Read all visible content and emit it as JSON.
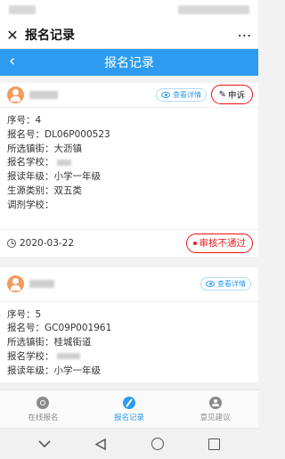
{
  "window": {
    "title": "报名记录",
    "close_icon": "✕",
    "more_icon": "⋯"
  },
  "header": {
    "title": "报名记录",
    "back_icon": "‹"
  },
  "records": [
    {
      "detail_label": "查看详情",
      "appeal_label": "申诉",
      "fields": [
        {
          "label": "序号：",
          "value": "4"
        },
        {
          "label": "报名号：",
          "value": "DL06P000523"
        },
        {
          "label": "所选镇街：",
          "value": "大沥镇"
        },
        {
          "label": "报名学校：",
          "value": ""
        },
        {
          "label": "报读年级：",
          "value": "小学一年级"
        },
        {
          "label": "生源类别：",
          "value": "双五类"
        },
        {
          "label": "调剂学校：",
          "value": ""
        }
      ],
      "date": "2020-03-22",
      "status": "审核不通过"
    },
    {
      "detail_label": "查看详情",
      "fields": [
        {
          "label": "序号：",
          "value": "5"
        },
        {
          "label": "报名号：",
          "value": "GC09P001961"
        },
        {
          "label": "所选镇街：",
          "value": "桂城街道"
        },
        {
          "label": "报名学校：",
          "value": ""
        },
        {
          "label": "报读年级：",
          "value": "小学一年级"
        }
      ]
    }
  ],
  "tabbar": {
    "items": [
      {
        "label": "在线报名",
        "icon": "register-icon",
        "active": false
      },
      {
        "label": "报名记录",
        "icon": "record-icon",
        "active": true
      },
      {
        "label": "意见建议",
        "icon": "feedback-icon",
        "active": false
      }
    ]
  },
  "colors": {
    "primary": "#2d9cf0",
    "error": "#e22222",
    "avatar": "#f39a5d"
  }
}
